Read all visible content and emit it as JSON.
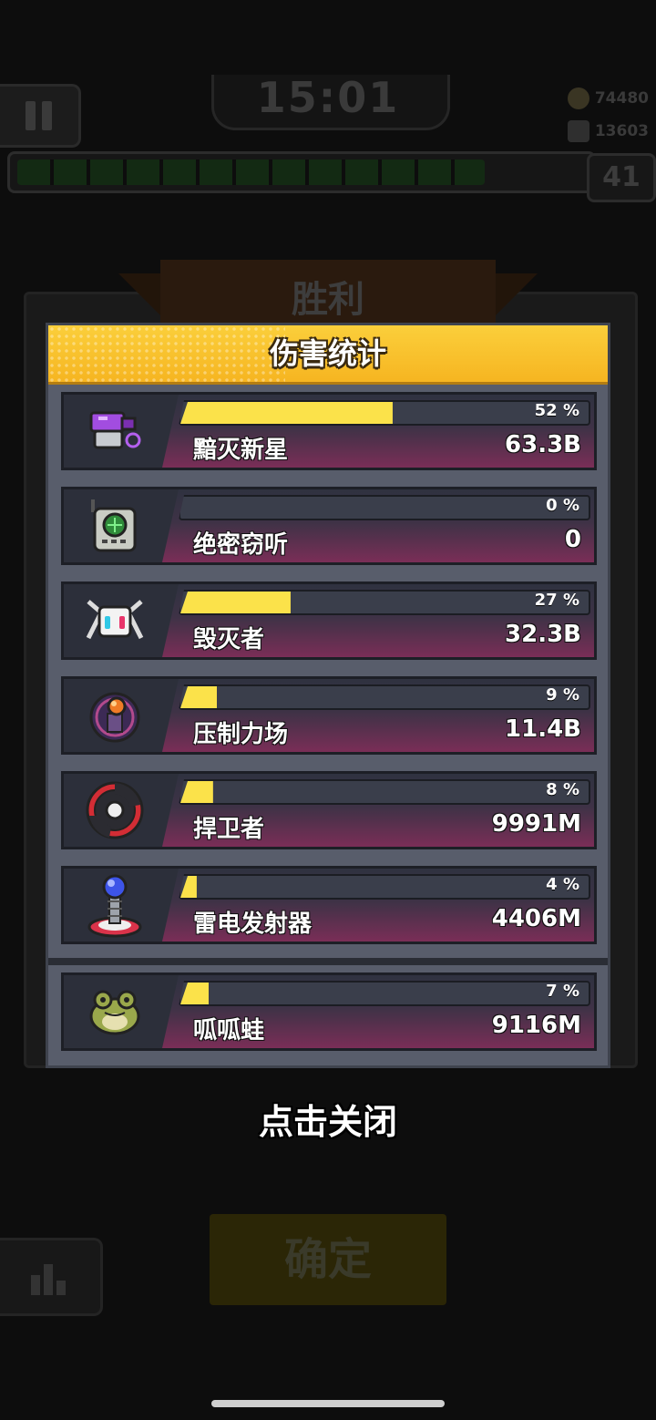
{
  "hud": {
    "timer": "15:01",
    "coins": "74480",
    "gems": "13603",
    "level": "41",
    "xp_progress": 0.82
  },
  "victory": {
    "label": "胜利"
  },
  "popup": {
    "title": "伤害统计",
    "weapons": [
      {
        "name": "黯灭新星",
        "percent_label": "52 %",
        "percent": 52,
        "damage": "63.3B",
        "icon": "purple-blaster-icon"
      },
      {
        "name": "绝密窃听",
        "percent_label": "0 %",
        "percent": 0,
        "damage": "0",
        "icon": "radio-device-icon"
      },
      {
        "name": "毁灭者",
        "percent_label": "27 %",
        "percent": 27,
        "damage": "32.3B",
        "icon": "robot-destroyer-icon"
      },
      {
        "name": "压制力场",
        "percent_label": "9 %",
        "percent": 9,
        "damage": "11.4B",
        "icon": "force-field-icon"
      },
      {
        "name": "捍卫者",
        "percent_label": "8 %",
        "percent": 8,
        "damage": "9991M",
        "icon": "guardian-ring-icon"
      },
      {
        "name": "雷电发射器",
        "percent_label": "4 %",
        "percent": 4,
        "damage": "4406M",
        "icon": "tesla-emitter-icon"
      }
    ],
    "pet": {
      "name": "呱呱蛙",
      "percent_label": "7 %",
      "percent": 7,
      "damage": "9116M",
      "icon": "frog-pet-icon"
    }
  },
  "close_hint": "点击关闭",
  "confirm_button": "确定",
  "colors": {
    "bar_fill": "#fbe24a",
    "header": "#f6b521",
    "panel": "#585d6b"
  }
}
